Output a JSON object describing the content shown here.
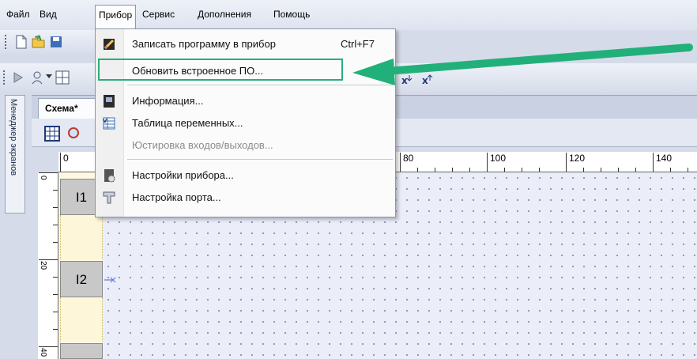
{
  "menubar": {
    "items": [
      {
        "label": "Файл"
      },
      {
        "label": "Вид"
      },
      {
        "label": "Прибор"
      },
      {
        "label": "Сервис"
      },
      {
        "label": "Дополнения"
      },
      {
        "label": "Помощь"
      }
    ]
  },
  "dropdown": {
    "items": [
      {
        "label": "Записать программу в прибор",
        "shortcut": "Ctrl+F7",
        "icon": "write-program-icon",
        "enabled": true
      },
      {
        "label": "Обновить встроенное ПО...",
        "shortcut": "",
        "icon": "",
        "enabled": true,
        "highlighted": true
      },
      {
        "label": "Информация...",
        "shortcut": "",
        "icon": "info-device-icon",
        "enabled": true
      },
      {
        "label": "Таблица переменных...",
        "shortcut": "",
        "icon": "variables-table-icon",
        "enabled": true
      },
      {
        "label": "Юстировка входов/выходов...",
        "shortcut": "",
        "icon": "",
        "enabled": false
      },
      {
        "label": "Настройки прибора...",
        "shortcut": "",
        "icon": "device-settings-icon",
        "enabled": true
      },
      {
        "label": "Настройка порта...",
        "shortcut": "",
        "icon": "port-settings-icon",
        "enabled": true
      }
    ]
  },
  "side_panel": {
    "label": "Менеджер экранов"
  },
  "document": {
    "tab_label": "Схема*",
    "ruler_h": [
      "0",
      "80",
      "100",
      "120",
      "140"
    ],
    "ruler_v": [
      "0",
      "20",
      "40"
    ],
    "blocks": [
      "I1",
      "I2"
    ]
  },
  "colors": {
    "highlight": "#2bad7b",
    "arrow": "#22b07a",
    "canvas": "#ebedf9",
    "block": "#c8c8c8"
  }
}
